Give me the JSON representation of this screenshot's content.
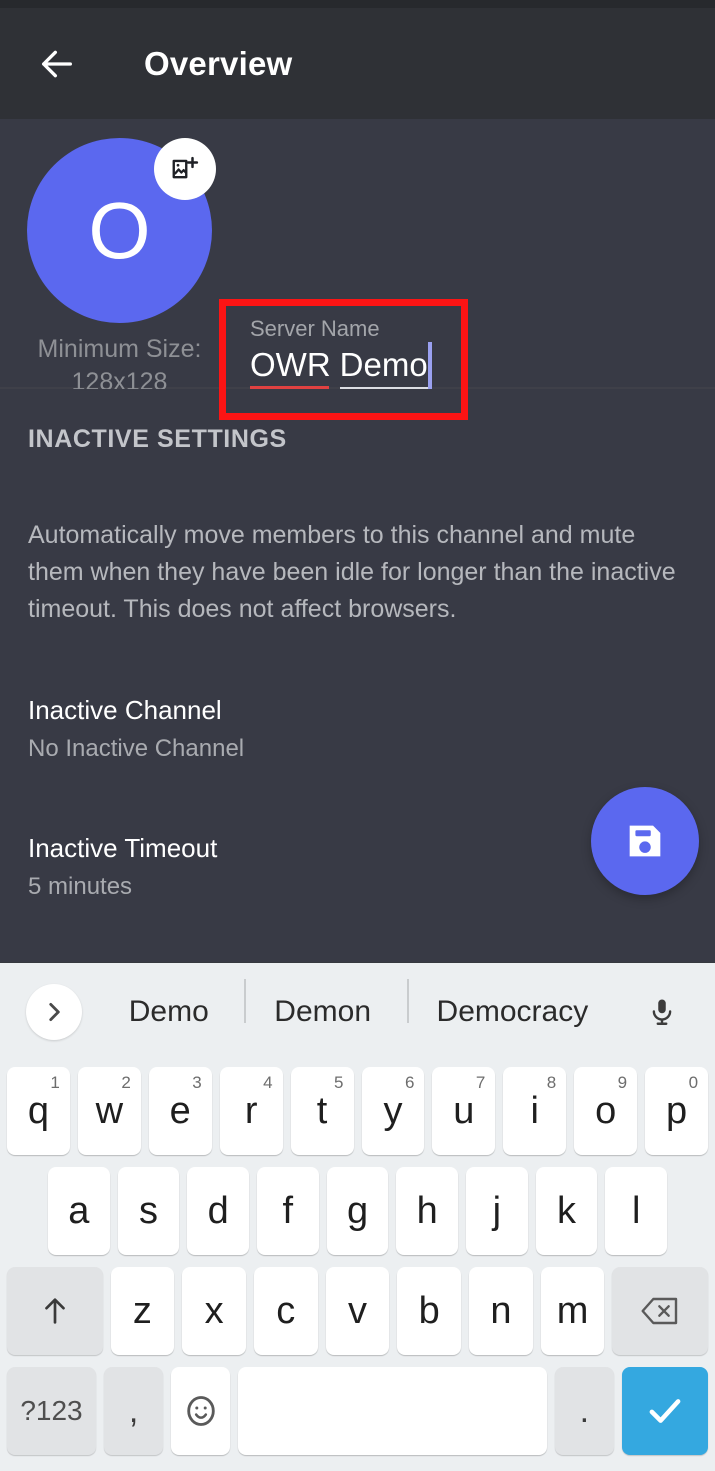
{
  "header": {
    "back_icon": "arrow-left-icon",
    "title": "Overview"
  },
  "identity": {
    "avatar_letter": "O",
    "avatar_color": "#5b68ef",
    "badge_icon": "add-image-icon",
    "caption_line1": "Minimum Size:",
    "caption_line2": "128x128",
    "server_name_label": "Server Name",
    "server_name_tokens": {
      "misspelled": "OWR",
      "composing": "Demo"
    },
    "server_name_value": "OWR Demo",
    "annotation_color": "#fc1414",
    "misspell_underline_color": "#e04141",
    "caret_color": "#9aa0f0"
  },
  "settings": {
    "section_title": "INACTIVE SETTINGS",
    "description": "Automatically move members to this channel and mute them when they have been idle for longer than the inactive timeout. This does not affect browsers.",
    "rows": [
      {
        "name": "Inactive Channel",
        "value": "No Inactive Channel"
      },
      {
        "name": "Inactive Timeout",
        "value": "5 minutes"
      }
    ],
    "save_fab_icon": "save-icon",
    "save_fab_color": "#5b68ef"
  },
  "keyboard": {
    "expand_icon": "chevron-right-icon",
    "mic_icon": "microphone-icon",
    "suggestions": [
      "Demo",
      "Demon",
      "Democracy"
    ],
    "row1": [
      {
        "label": "q",
        "sup": "1"
      },
      {
        "label": "w",
        "sup": "2"
      },
      {
        "label": "e",
        "sup": "3"
      },
      {
        "label": "r",
        "sup": "4"
      },
      {
        "label": "t",
        "sup": "5"
      },
      {
        "label": "y",
        "sup": "6"
      },
      {
        "label": "u",
        "sup": "7"
      },
      {
        "label": "i",
        "sup": "8"
      },
      {
        "label": "o",
        "sup": "9"
      },
      {
        "label": "p",
        "sup": "0"
      }
    ],
    "row2": [
      {
        "label": "a"
      },
      {
        "label": "s"
      },
      {
        "label": "d"
      },
      {
        "label": "f"
      },
      {
        "label": "g"
      },
      {
        "label": "h"
      },
      {
        "label": "j"
      },
      {
        "label": "k"
      },
      {
        "label": "l"
      }
    ],
    "row3": [
      {
        "label": "z"
      },
      {
        "label": "x"
      },
      {
        "label": "c"
      },
      {
        "label": "v"
      },
      {
        "label": "b"
      },
      {
        "label": "n"
      },
      {
        "label": "m"
      }
    ],
    "shift_icon": "shift-arrow-up-icon",
    "backspace_icon": "backspace-icon",
    "symbols_label": "?123",
    "comma_label": ",",
    "emoji_icon": "emoji-smiley-icon",
    "space_label": "",
    "period_label": ".",
    "enter_icon": "checkmark-icon",
    "enter_color": "#34a8e0"
  }
}
